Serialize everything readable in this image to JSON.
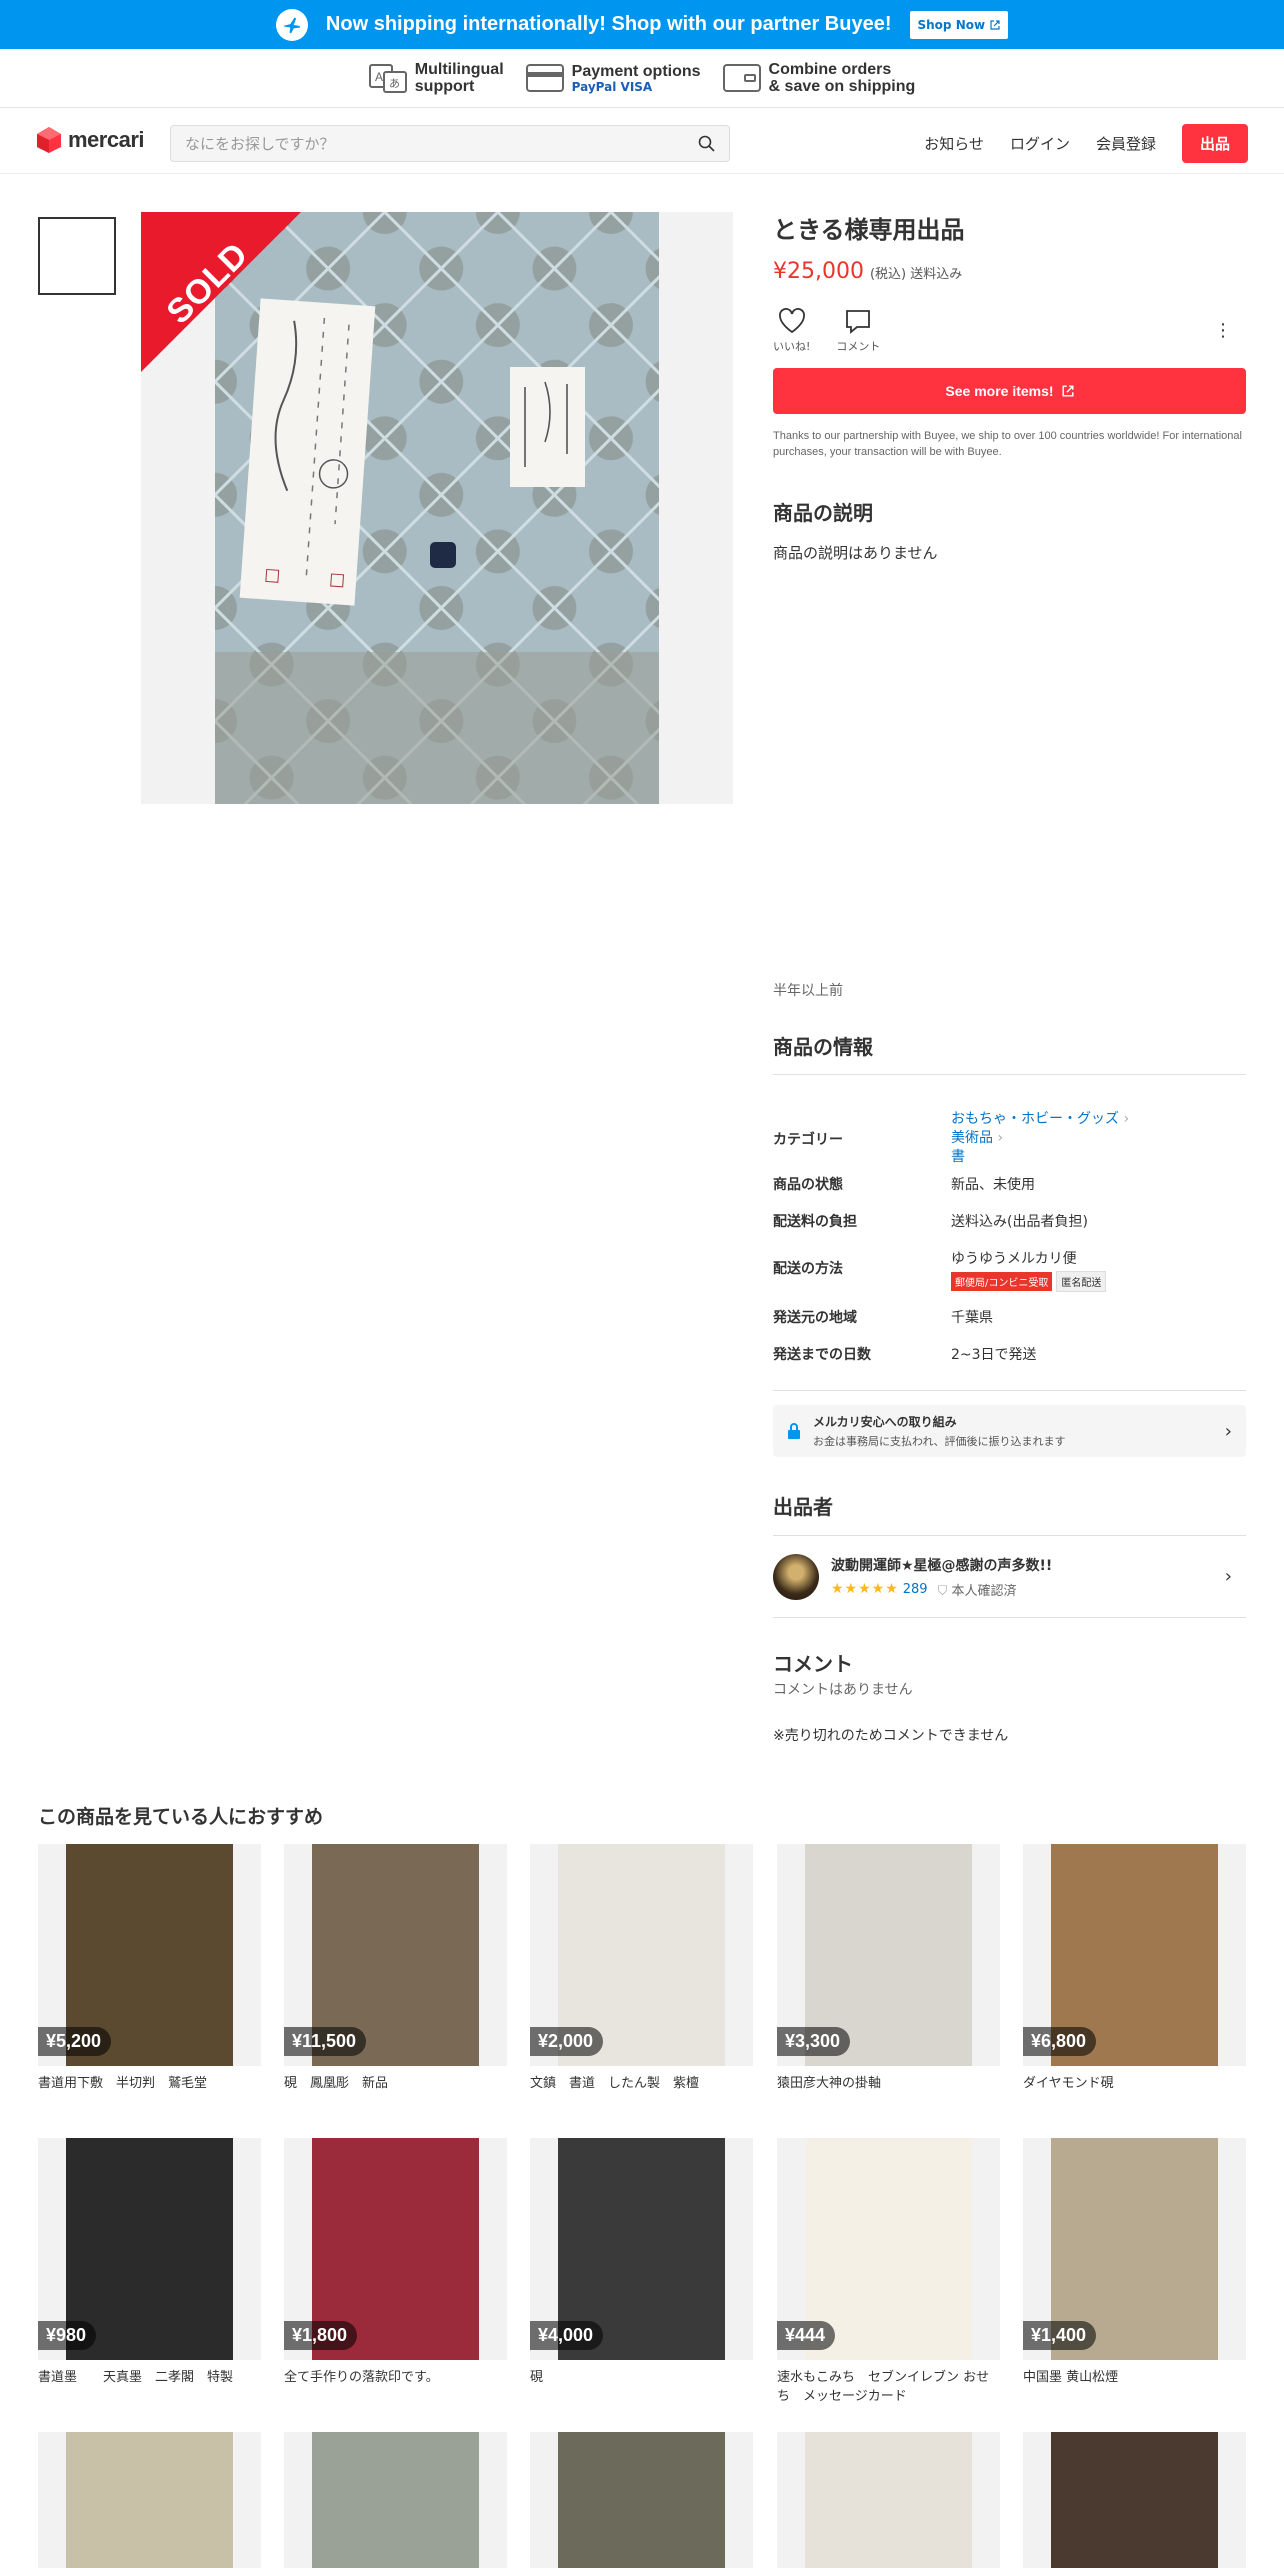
{
  "banner": {
    "text": "Now shipping internationally! Shop with our partner Buyee!",
    "button": "Shop Now"
  },
  "features": [
    {
      "title": "Multilingual",
      "sub": "support",
      "icon": "translate-icon"
    },
    {
      "title": "Payment options",
      "sub": "PayPal VISA",
      "icon": "credit-card-icon"
    },
    {
      "title": "Combine orders",
      "sub": "& save on shipping",
      "icon": "wallet-icon"
    }
  ],
  "header": {
    "logo": "mercari",
    "search_placeholder": "なにをお探しですか？",
    "nav": [
      "お知らせ",
      "ログイン",
      "会員登録"
    ],
    "sell": "出品"
  },
  "item": {
    "sold_label": "SOLD",
    "title": "ときる様専用出品",
    "price": "¥25,000",
    "tax": "(税込) 送料込み",
    "like_label": "いいね!",
    "comment_label": "コメント",
    "see_more": "See more items!",
    "partner_note": "Thanks to our partnership with Buyee, we ship to over 100 countries worldwide! For international purchases, your transaction will be with Buyee.",
    "desc_heading": "商品の説明",
    "desc": "商品の説明はありません",
    "posted": "半年以上前",
    "info_heading": "商品の情報",
    "info": {
      "category_label": "カテゴリー",
      "categories": [
        "おもちゃ・ホビー・グッズ",
        "美術品",
        "書"
      ],
      "condition_label": "商品の状態",
      "condition": "新品、未使用",
      "shipping_fee_label": "配送料の負担",
      "shipping_fee": "送料込み(出品者負担)",
      "method_label": "配送の方法",
      "method": "ゆうゆうメルカリ便",
      "method_tags": [
        "郵便局/コンビニ受取",
        "匿名配送"
      ],
      "from_label": "発送元の地域",
      "from": "千葉県",
      "days_label": "発送までの日数",
      "days": "2~3日で発送"
    },
    "safety_title": "メルカリ安心への取り組み",
    "safety_sub": "お金は事務局に支払われ、評価後に振り込まれます",
    "seller_heading": "出品者",
    "seller_name": "波動開運師★星極@感謝の声多数!!",
    "seller_rating_count": "289",
    "seller_verified": "本人確認済",
    "comment_heading": "コメント",
    "comment_none": "コメントはありません",
    "comment_sold": "※売り切れのためコメントできません"
  },
  "recommend": {
    "heading": "この商品を見ている人におすすめ",
    "items": [
      {
        "price": "¥5,200",
        "name": "書道用下敷　半切判　鷲毛堂",
        "bg": "#5c4a30"
      },
      {
        "price": "¥11,500",
        "name": "硯　鳳凰彫　新品",
        "bg": "#7a6a55"
      },
      {
        "price": "¥2,000",
        "name": "文鎮　書道　したん製　紫檀",
        "bg": "#e8e4de"
      },
      {
        "price": "¥3,300",
        "name": "猿田彦大神の掛軸",
        "bg": "#d9d6d0"
      },
      {
        "price": "¥6,800",
        "name": "ダイヤモンド硯",
        "bg": "#a07850"
      },
      {
        "price": "¥980",
        "name": "書道墨　　天真墨　二孝閣　特製",
        "bg": "#2b2b2b"
      },
      {
        "price": "¥1,800",
        "name": "全て手作りの落款印です。",
        "bg": "#9b2a3a"
      },
      {
        "price": "¥4,000",
        "name": "硯",
        "bg": "#3a3a3a"
      },
      {
        "price": "¥444",
        "name": "速水もこみち　セブンイレブン おせち　メッセージカード",
        "bg": "#f4f0e6"
      },
      {
        "price": "¥1,400",
        "name": "中国墨 黄山松煙",
        "bg": "#b7aa90"
      },
      {
        "price": "",
        "name": "",
        "bg": "#c9c0a8"
      },
      {
        "price": "",
        "name": "",
        "bg": "#9aa298"
      },
      {
        "price": "",
        "name": "",
        "bg": "#6c6a5a"
      },
      {
        "price": "",
        "name": "",
        "bg": "#e6e2da"
      },
      {
        "price": "",
        "name": "",
        "bg": "#4a3a30"
      }
    ]
  }
}
